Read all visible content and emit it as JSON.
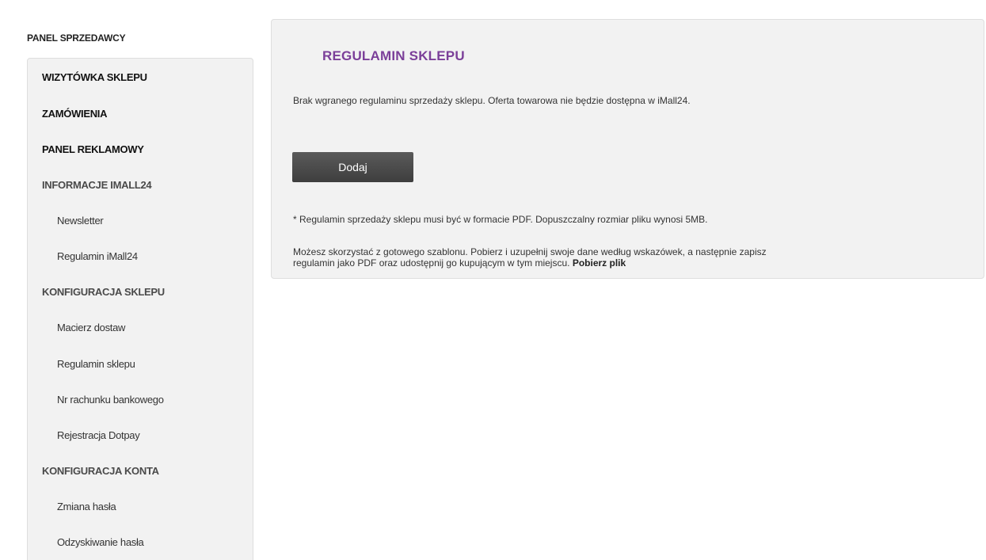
{
  "sidebar": {
    "title": "PANEL SPRZEDAWCY",
    "items": [
      {
        "label": "WIZYTÓWKA SKLEPU"
      },
      {
        "label": "ZAMÓWIENIA"
      },
      {
        "label": "PANEL REKLAMOWY"
      },
      {
        "label": "INFORMACJE IMALL24"
      },
      {
        "label": "Newsletter"
      },
      {
        "label": "Regulamin iMall24"
      },
      {
        "label": "KONFIGURACJA SKLEPU"
      },
      {
        "label": "Macierz dostaw"
      },
      {
        "label": "Regulamin sklepu"
      },
      {
        "label": "Nr rachunku bankowego"
      },
      {
        "label": "Rejestracja Dotpay"
      },
      {
        "label": "KONFIGURACJA KONTA"
      },
      {
        "label": "Zmiana hasła"
      },
      {
        "label": "Odzyskiwanie hasła"
      }
    ]
  },
  "main": {
    "title": "REGULAMIN SKLEPU",
    "notice": "Brak wgranego regulaminu sprzedaży sklepu. Oferta towarowa nie będzie dostępna w iMall24.",
    "add_button_label": "Dodaj",
    "pdf_note": "* Regulamin sprzedaży sklepu musi być w formacie PDF. Dopuszczalny rozmiar pliku wynosi 5MB.",
    "template_note_line1": "Możesz skorzystać z gotowego szablonu. Pobierz i uzupełnij swoje dane według wskazówek, a następnie zapisz",
    "template_note_line2": "regulamin jako PDF oraz udostępnij go kupującym w tym miejscu.",
    "download_link": "Pobierz plik"
  },
  "colors": {
    "accent_title": "#7b3f99",
    "button_bg": "#4a4a4a",
    "panel_bg": "#f2f2f2"
  }
}
